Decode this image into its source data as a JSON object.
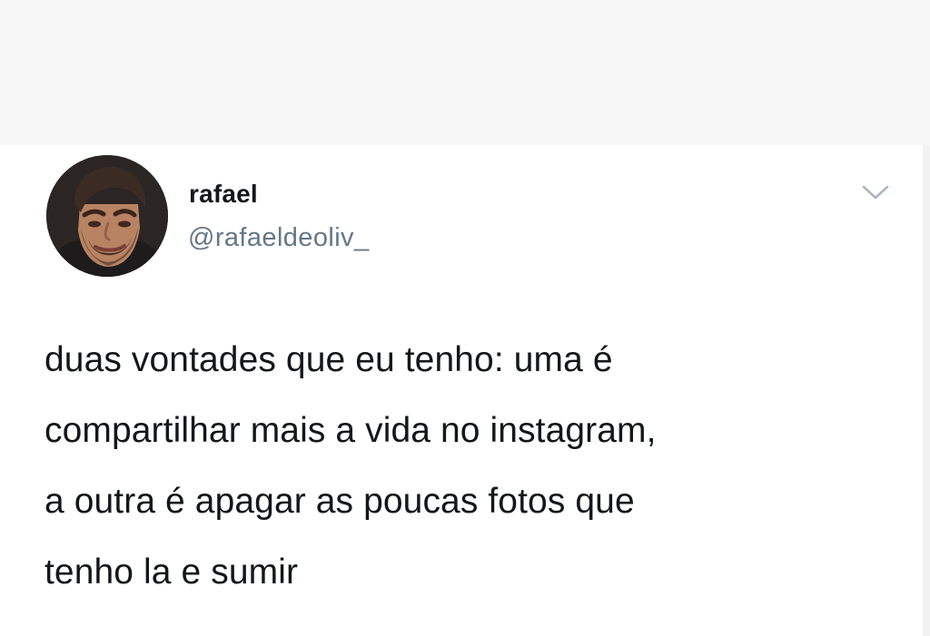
{
  "tweet": {
    "author": {
      "display_name": "rafael",
      "handle": "@rafaeldeoliv_",
      "avatar_icon": "profile-photo"
    },
    "menu_icon": "chevron-down-icon",
    "text_lines": [
      "duas vontades que eu tenho: uma é",
      "compartilhar mais a vida no instagram,",
      "a outra é apagar as poucas fotos que",
      "tenho la e sumir"
    ]
  },
  "colors": {
    "background": "#f6f6f6",
    "card": "#ffffff",
    "name_text": "#14171a",
    "handle_text": "#657786",
    "chevron": "#aab8c2"
  }
}
